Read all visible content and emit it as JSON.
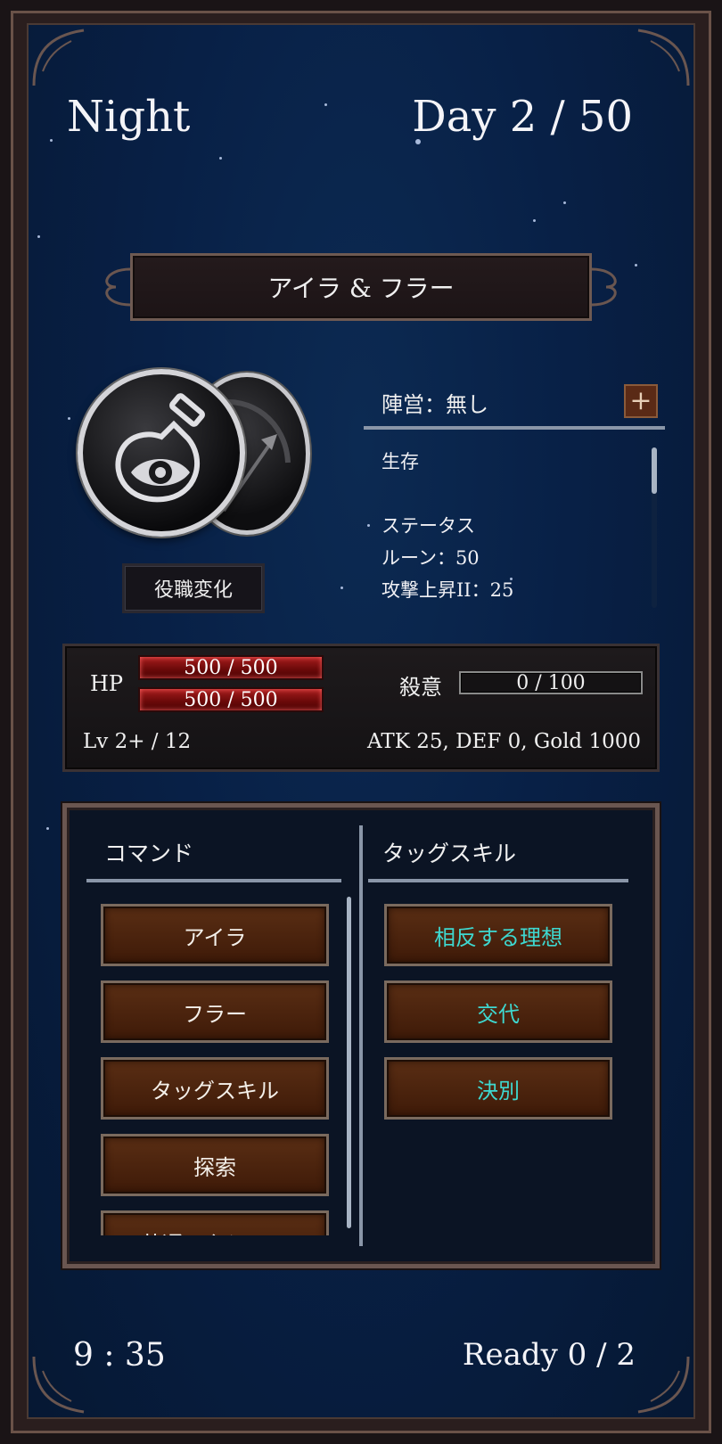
{
  "hud": {
    "phase": "Night",
    "day": "Day 2 / 50",
    "timer": "9 : 35",
    "ready": "Ready 0 / 2"
  },
  "character": {
    "name": "アイラ & フラー",
    "job_change_label": "役職変化",
    "front_portrait_icon": "potion-eye-icon",
    "back_portrait_icon": "arrow-icon"
  },
  "faction": {
    "label": "陣営：無し",
    "add_label": "+"
  },
  "status": {
    "lines": [
      "生存",
      "",
      "ステータス",
      "ルーン：50",
      "攻撃上昇II：25"
    ]
  },
  "stats": {
    "hp_label": "HP",
    "hp1": "500 / 500",
    "hp2": "500 / 500",
    "kill_label": "殺意",
    "kill_value": "0 / 100",
    "level": "Lv 2+ / 12",
    "summary": "ATK 25, DEF 0, Gold 1000"
  },
  "commands": {
    "header": "コマンド",
    "items": [
      "アイラ",
      "フラー",
      "タッグスキル",
      "探索",
      "共通アクション"
    ]
  },
  "tag_skills": {
    "header": "タッグスキル",
    "items": [
      "相反する理想",
      "交代",
      "決別"
    ]
  },
  "colors": {
    "sky": "#082046",
    "skill_text": "#3ed8d0",
    "hp_bar": "#a81e1e",
    "button": "#5a2e14"
  }
}
